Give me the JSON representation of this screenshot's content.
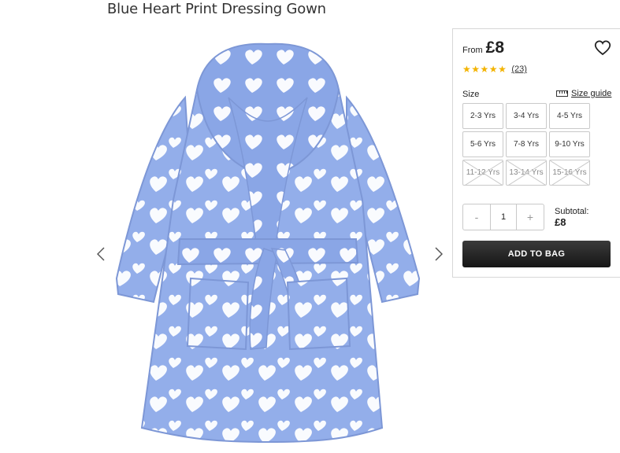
{
  "product": {
    "title": "Blue Heart Print Dressing Gown",
    "from_label": "From",
    "price": "£8",
    "rating_stars": 5,
    "review_count": "(23)"
  },
  "size": {
    "label": "Size",
    "guide_label": "Size guide",
    "options": [
      {
        "label": "2-3 Yrs",
        "available": true
      },
      {
        "label": "3-4 Yrs",
        "available": true
      },
      {
        "label": "4-5 Yrs",
        "available": true
      },
      {
        "label": "5-6 Yrs",
        "available": true
      },
      {
        "label": "7-8 Yrs",
        "available": true
      },
      {
        "label": "9-10 Yrs",
        "available": true
      },
      {
        "label": "11-12 Yrs",
        "available": false
      },
      {
        "label": "13-14 Yrs",
        "available": false
      },
      {
        "label": "15-16 Yrs",
        "available": false
      }
    ]
  },
  "quantity": {
    "minus": "-",
    "value": "1",
    "plus": "+"
  },
  "subtotal": {
    "label": "Subtotal:",
    "amount": "£8"
  },
  "actions": {
    "add_to_bag": "ADD TO BAG"
  },
  "icons": {
    "wishlist": "heart-outline-icon",
    "prev": "chevron-left-icon",
    "next": "chevron-right-icon",
    "size_guide": "ruler-icon",
    "star": "star-icon"
  },
  "colors": {
    "gown_blue": "#8ea8e6",
    "star": "#f3b300",
    "button_dark": "#222222"
  }
}
